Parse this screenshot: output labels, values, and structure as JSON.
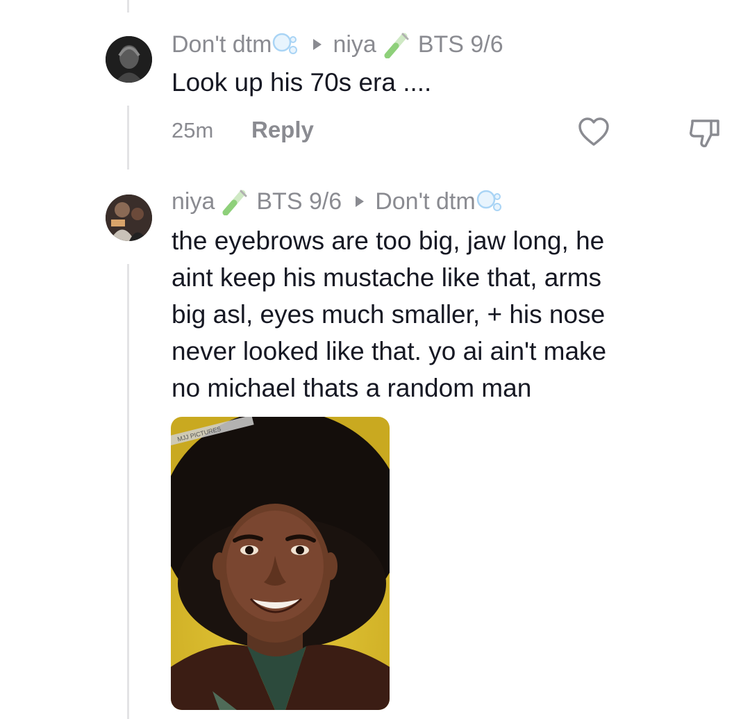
{
  "comment1": {
    "author": "Don't dtm",
    "reply_to_name": "niya",
    "reply_to_tag": "BTS 9/6",
    "text": "Look up his 70s era ....",
    "time": "25m",
    "reply_label": "Reply"
  },
  "comment2": {
    "author": "niya",
    "author_tag": "BTS 9/6",
    "reply_to_name": "Don't dtm",
    "text_lines": [
      "the eyebrows are too big, jaw long, he",
      "aint keep his mustache like that, arms",
      "big asl, eyes much smaller, + his nose",
      "never looked like that. yo ai ain't make",
      "no michael thats a random man"
    ],
    "image_watermark": "MJJ PICTURES"
  },
  "colors": {
    "muted_text": "#8a8b91",
    "body_text": "#161823",
    "thread_line": "#e3e3e5",
    "tube_green": "#8ed07a",
    "bubble_blue": "#a9d4f5"
  },
  "icons": [
    "bubble-icon",
    "test-tube-icon",
    "heart-icon",
    "dislike-icon",
    "play-arrow-icon"
  ]
}
